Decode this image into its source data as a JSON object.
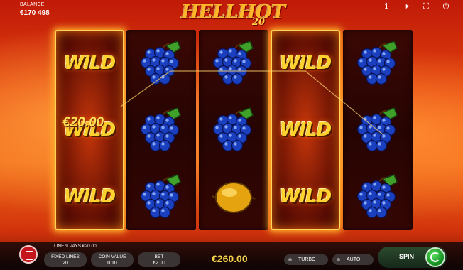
{
  "header": {
    "balance_label": "BALANCE",
    "balance_value": "€170 498",
    "logo_main": "HELLHOT",
    "logo_sub": "20",
    "icons": [
      "info-icon",
      "sound-off-icon",
      "fullscreen-icon",
      "power-icon"
    ]
  },
  "reels": {
    "grid": [
      [
        "wild",
        "wild",
        "wild"
      ],
      [
        "grapes",
        "grapes",
        "grapes"
      ],
      [
        "grapes",
        "grapes",
        "lemon"
      ],
      [
        "wild",
        "wild",
        "wild"
      ],
      [
        "grapes",
        "grapes",
        "grapes"
      ]
    ],
    "hot_reels": [
      0,
      3
    ],
    "wild_label": "WILD",
    "win_amount": "€20.00"
  },
  "bottom": {
    "win_line": "LINE 9 PAYS €20.00",
    "fixed_lines_label": "FIXED LINES",
    "fixed_lines_value": "20",
    "coin_value_label": "COIN VALUE",
    "coin_value_value": "0.10",
    "bet_label": "BET",
    "bet_value": "€2.00",
    "total_win": "€260.00",
    "turbo_label": "TURBO",
    "auto_label": "AUTO",
    "spin_label": "SPIN"
  },
  "colors": {
    "accent_gold": "#f4d54a",
    "menu_red": "#c4161c",
    "spin_green": "#1fa33a"
  }
}
